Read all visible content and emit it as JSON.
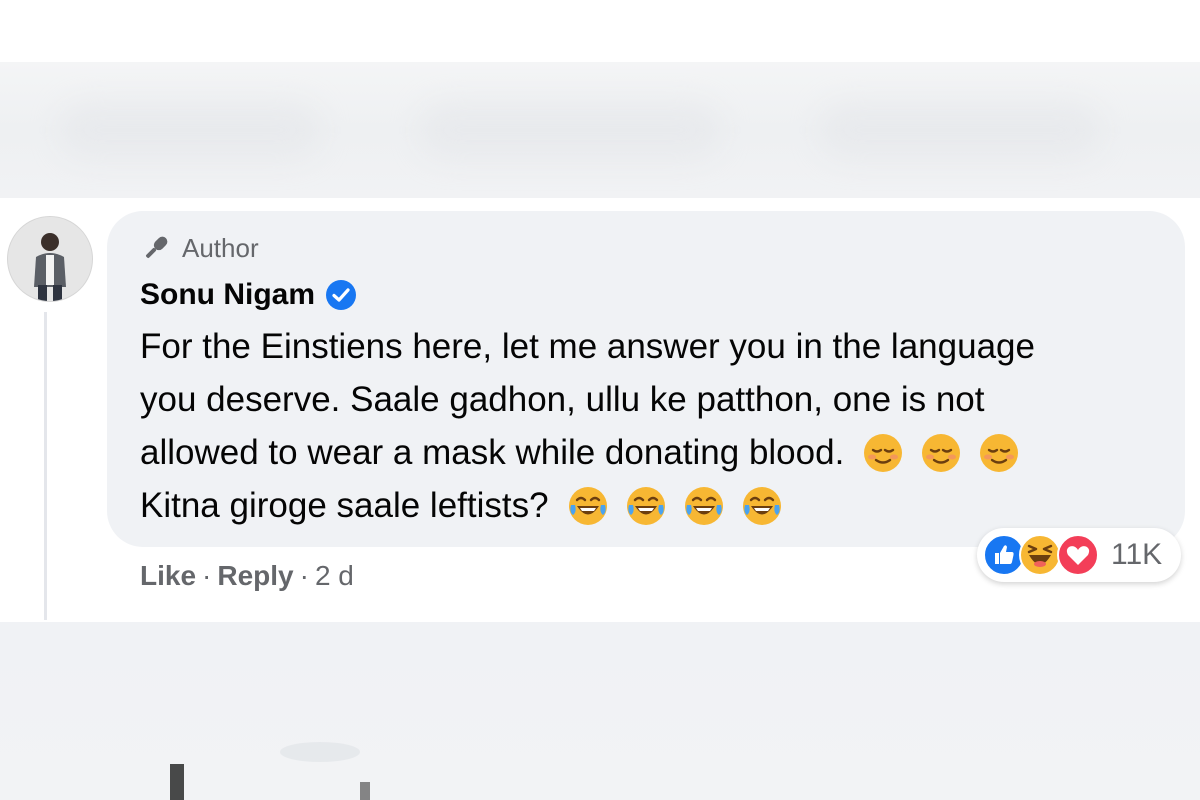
{
  "comment": {
    "badge_label": "Author",
    "author_name": "Sonu Nigam",
    "text_lines": [
      "For the Einstiens here, let me answer you in the language",
      "you deserve. Saale gadhon, ullu ke patthon, one is not",
      "allowed to wear a mask while donating blood.",
      "Kitna giroge saale leftists?"
    ],
    "reactions_count": "11K",
    "actions": {
      "like": "Like",
      "reply": "Reply",
      "separator": "·",
      "time": "2 d"
    }
  },
  "colors": {
    "bubble": "#f0f2f5",
    "verified": "#1877f2",
    "secondary_text": "#65676b"
  },
  "icons": [
    "microphone-icon",
    "verified-icon",
    "relieved-face-emoji",
    "tears-of-joy-emoji",
    "like-reaction-icon",
    "haha-reaction-icon",
    "love-reaction-icon"
  ]
}
